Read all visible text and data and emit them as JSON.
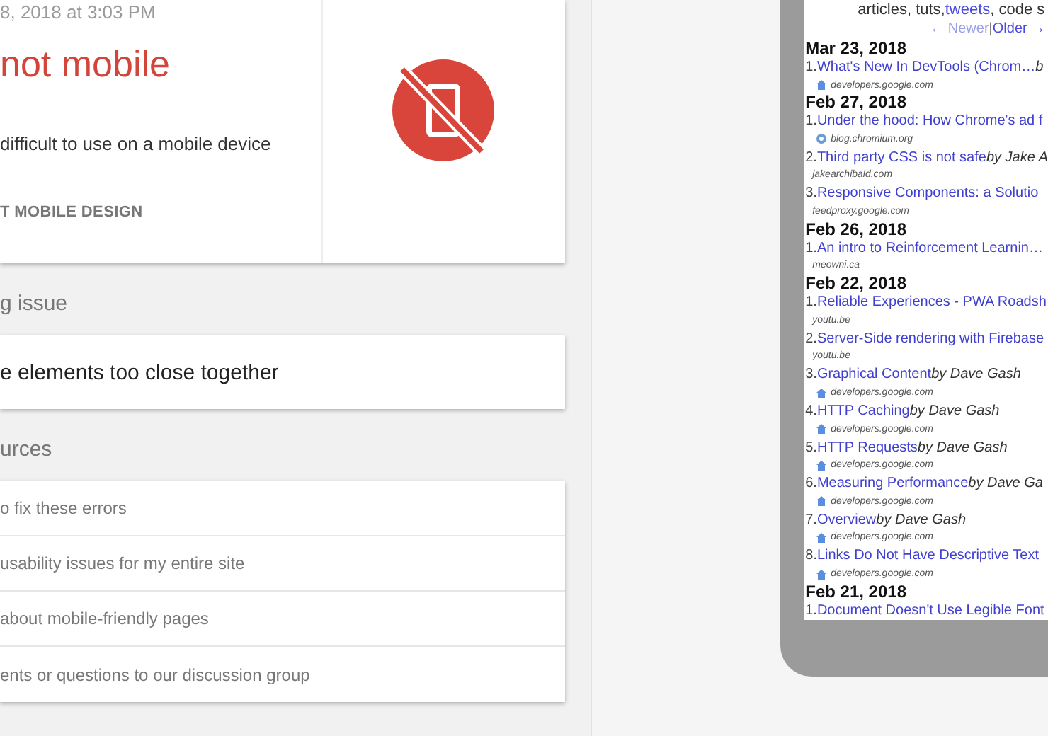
{
  "result_card": {
    "date": "8, 2018 at 3:03 PM",
    "verdict": "not mobile",
    "description": "difficult to use on a mobile device",
    "link": "T MOBILE DESIGN"
  },
  "issues_heading": "g issue",
  "issues": [
    "e elements too close together"
  ],
  "resources_heading": "urces",
  "resources": [
    "o fix these errors",
    "usability issues for my entire site",
    "about mobile-friendly pages",
    "ents or questions to our discussion group"
  ],
  "phone": {
    "intro": [
      {
        "kind": "text",
        "text": "articles, tuts,"
      },
      {
        "kind": "link",
        "text": "tweets"
      },
      {
        "kind": "text",
        "text": ", code s"
      }
    ],
    "pager": {
      "newer": "← Newer",
      "separator": "|",
      "older": "Older →"
    },
    "groups": [
      {
        "date": "Mar 23, 2018",
        "items": [
          {
            "kind": "house",
            "number": "1.",
            "title": "What's New In DevTools (Chrom…",
            "author": "b",
            "source": "developers.google.com"
          }
        ]
      },
      {
        "date": "Feb 27, 2018",
        "items": [
          {
            "kind": "ring",
            "number": "1.",
            "title": "Under the hood: How Chrome's ad f",
            "source": "blog.chromium.org"
          },
          {
            "kind": "plain",
            "number": "2.",
            "title": "Third party CSS is not safe",
            "author": "by Jake A",
            "source": "jakearchibald.com"
          },
          {
            "kind": "plain",
            "number": "3.",
            "title": "Responsive Components: a Solutio",
            "source": "feedproxy.google.com"
          }
        ]
      },
      {
        "date": "Feb 26, 2018",
        "items": [
          {
            "kind": "plain",
            "number": "1.",
            "title": "An intro to Reinforcement Learnin…",
            "source": "meowni.ca"
          }
        ]
      },
      {
        "date": "Feb 22, 2018",
        "items": [
          {
            "kind": "plain",
            "number": "1.",
            "title": "Reliable Experiences - PWA Roadsh",
            "source": "youtu.be"
          },
          {
            "kind": "plain",
            "number": "2.",
            "title": "Server-Side rendering with Firebase",
            "source": "youtu.be"
          },
          {
            "kind": "house",
            "number": "3.",
            "title": "Graphical Content",
            "author": "by Dave Gash",
            "source": "developers.google.com"
          },
          {
            "kind": "house",
            "number": "4.",
            "title": "HTTP Caching",
            "author": "by Dave Gash",
            "source": "developers.google.com"
          },
          {
            "kind": "house",
            "number": "5.",
            "title": "HTTP Requests",
            "author": "by Dave Gash",
            "source": "developers.google.com"
          },
          {
            "kind": "house",
            "number": "6.",
            "title": "Measuring Performance",
            "author": "by Dave Ga",
            "source": "developers.google.com"
          },
          {
            "kind": "house",
            "number": "7.",
            "title": "Overview",
            "author": "by Dave Gash",
            "source": "developers.google.com"
          },
          {
            "kind": "house",
            "number": "8.",
            "title": "Links Do Not Have Descriptive Text",
            "source": "developers.google.com"
          }
        ]
      },
      {
        "date": "Feb 21, 2018",
        "items": [
          {
            "number": "1.",
            "title": "Document Doesn't Use Legible Font"
          }
        ]
      }
    ]
  }
}
